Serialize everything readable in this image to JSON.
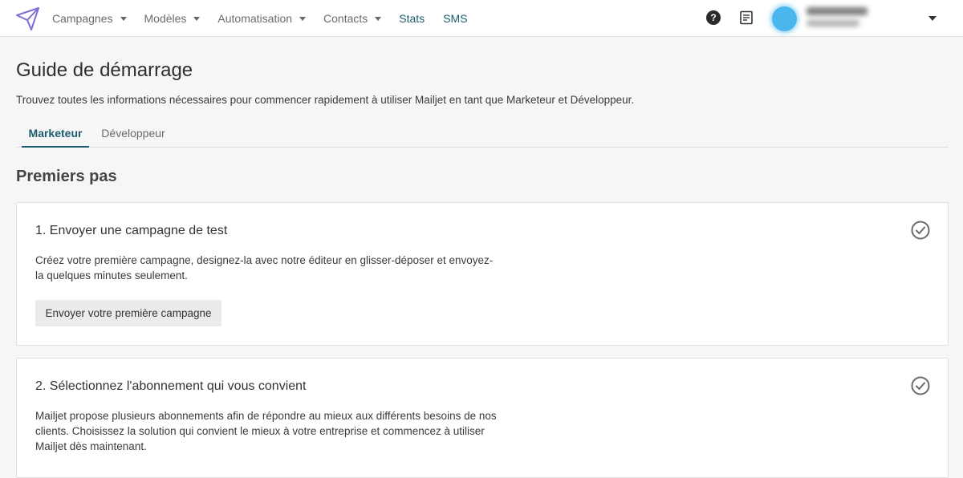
{
  "nav": {
    "items": [
      {
        "label": "Campagnes",
        "dropdown": true
      },
      {
        "label": "Modèles",
        "dropdown": true
      },
      {
        "label": "Automatisation",
        "dropdown": true
      },
      {
        "label": "Contacts",
        "dropdown": true
      },
      {
        "label": "Stats",
        "dropdown": false
      },
      {
        "label": "SMS",
        "dropdown": false
      }
    ],
    "help_glyph": "?",
    "brand_color": "#7b6fd6",
    "accent_color": "#1b5c6e"
  },
  "page": {
    "title": "Guide de démarrage",
    "description": "Trouvez toutes les informations nécessaires pour commencer rapidement à utiliser Mailjet en tant que Marketeur et Développeur.",
    "tabs": [
      {
        "label": "Marketeur",
        "active": true
      },
      {
        "label": "Développeur",
        "active": false
      }
    ],
    "section_title": "Premiers pas"
  },
  "cards": [
    {
      "title": "1. Envoyer une campagne de test",
      "text": "Créez votre première campagne, designez-la avec notre éditeur en glisser-déposer et envoyez-la quelques minutes seulement.",
      "button": "Envoyer votre première campagne",
      "completed": true
    },
    {
      "title": "2. Sélectionnez l'abonnement qui vous convient",
      "text": "Mailjet propose plusieurs abonnements afin de répondre au mieux aux différents besoins de nos clients. Choisissez la solution qui convient le mieux à votre entreprise et commencez à utiliser Mailjet dès maintenant.",
      "completed": true
    }
  ]
}
